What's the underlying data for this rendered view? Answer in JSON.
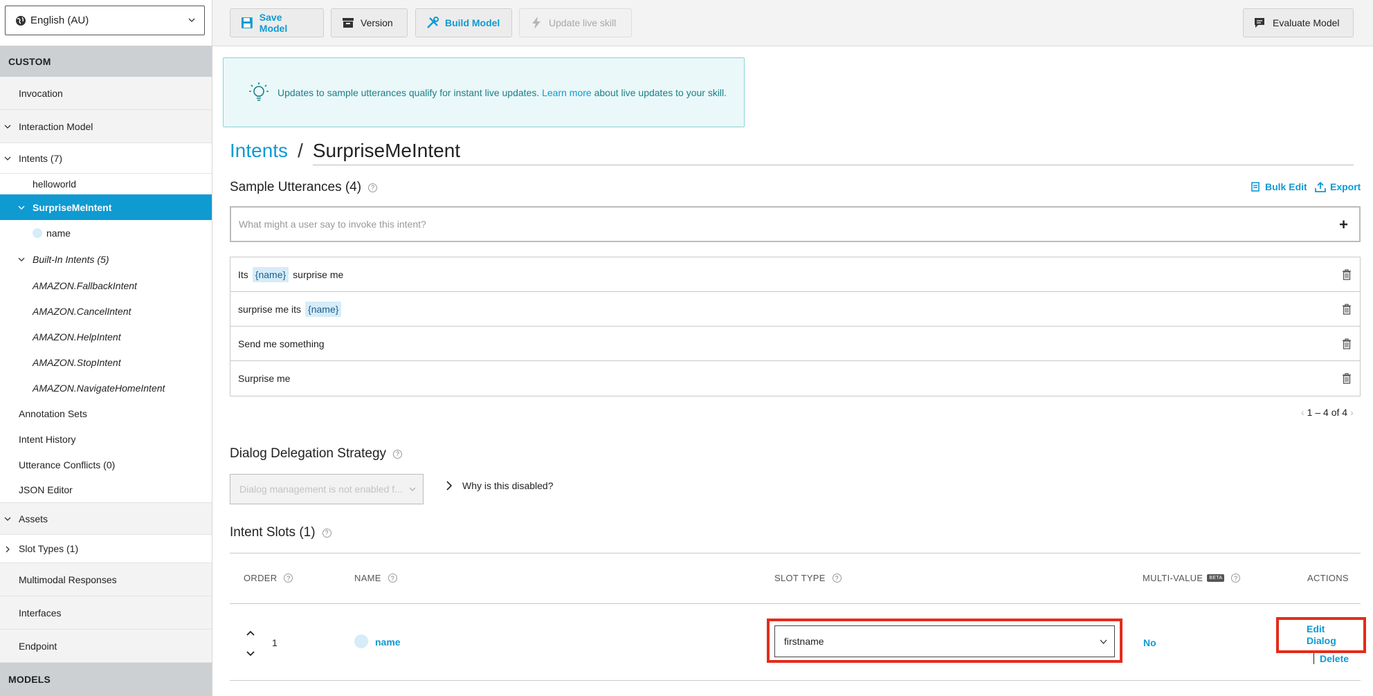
{
  "language": {
    "selected": "English (AU)"
  },
  "sidebar": {
    "section_custom": "CUSTOM",
    "section_models": "MODELS",
    "invocation": "Invocation",
    "interaction_model": "Interaction Model",
    "intents": "Intents (7)",
    "intent_helloworld": "helloworld",
    "intent_surprise": "SurpriseMeIntent",
    "slot_name": "name",
    "builtin": "Built-In Intents (5)",
    "builtin_items": [
      "AMAZON.FallbackIntent",
      "AMAZON.CancelIntent",
      "AMAZON.HelpIntent",
      "AMAZON.StopIntent",
      "AMAZON.NavigateHomeIntent"
    ],
    "annotation_sets": "Annotation Sets",
    "intent_history": "Intent History",
    "utterance_conflicts": "Utterance Conflicts (0)",
    "json_editor": "JSON Editor",
    "assets": "Assets",
    "slot_types": "Slot Types (1)",
    "multimodal": "Multimodal Responses",
    "interfaces": "Interfaces",
    "endpoint": "Endpoint"
  },
  "toolbar": {
    "save": "Save Model",
    "version": "Version",
    "build": "Build Model",
    "update_live": "Update live skill",
    "evaluate": "Evaluate Model"
  },
  "banner": {
    "text_before": "Updates to sample utterances qualify for instant live updates.",
    "link": "Learn more",
    "text_after": "about live updates to your skill."
  },
  "breadcrumb": {
    "intents": "Intents",
    "separator": "/",
    "current": "SurpriseMeIntent"
  },
  "utterances": {
    "title": "Sample Utterances (4)",
    "bulk_edit": "Bulk Edit",
    "export": "Export",
    "placeholder": "What might a user say to invoke this intent?",
    "plus": "+",
    "rows": [
      {
        "pre": "Its",
        "slot": "{name}",
        "post": "surprise me"
      },
      {
        "pre": "surprise me its",
        "slot": "{name}",
        "post": ""
      },
      {
        "pre": "Send me something",
        "slot": "",
        "post": ""
      },
      {
        "pre": "Surprise me",
        "slot": "",
        "post": ""
      }
    ],
    "pagination": "1 – 4 of 4"
  },
  "dialog": {
    "title": "Dialog Delegation Strategy",
    "select_placeholder": "Dialog management is not enabled f...",
    "why": "Why is this disabled?"
  },
  "slots": {
    "title": "Intent Slots (1)",
    "headers": {
      "order": "ORDER",
      "name": "NAME",
      "slot_type": "SLOT TYPE",
      "multi_value": "MULTI-VALUE",
      "beta": "BETA",
      "actions": "ACTIONS"
    },
    "row": {
      "order": "1",
      "name": "name",
      "slot_type": "firstname",
      "multi_value": "No",
      "edit": "Edit Dialog",
      "delete": "Delete"
    }
  },
  "colors": {
    "accent": "#0f9ad2",
    "highlight": "#e52b1a",
    "sidebar_selected": "#0f9ad2"
  }
}
